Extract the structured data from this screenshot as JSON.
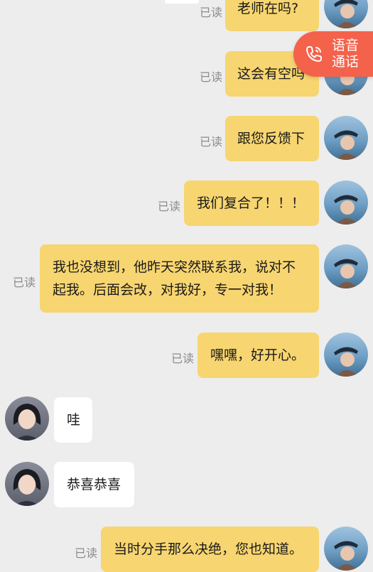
{
  "call_button": {
    "line1": "语音",
    "line2": "通话"
  },
  "messages": [
    {
      "text": "老师在吗?",
      "read": "已读"
    },
    {
      "text": "这会有空吗",
      "read": "已读"
    },
    {
      "text": "跟您反馈下",
      "read": "已读"
    },
    {
      "text": "我们复合了！！！",
      "read": "已读"
    },
    {
      "line1": "我也没想到，他昨天突然联系我，说对不",
      "line2": "起我。后面会改，对我好，专一对我！",
      "read": "已读"
    },
    {
      "text": "嘿嘿，好开心。",
      "read": "已读"
    },
    {
      "text": "哇"
    },
    {
      "text": "恭喜恭喜"
    },
    {
      "text": "当时分手那么决绝，您也知道。",
      "read": "已读"
    }
  ],
  "colors": {
    "background": "#ededed",
    "my_bubble": "#f7d570",
    "their_bubble": "#ffffff",
    "call_button": "#f4624b"
  }
}
